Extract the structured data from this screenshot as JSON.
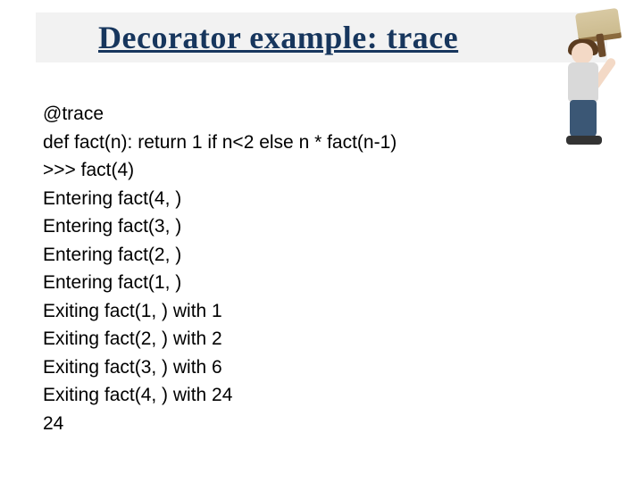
{
  "title": "Decorator example: trace",
  "code_lines": [
    "@trace",
    "def fact(n): return 1 if n<2 else n * fact(n-1)",
    ">>> fact(4)",
    "Entering fact(4, )",
    "Entering fact(3, )",
    "Entering fact(2, )",
    "Entering fact(1, )",
    "Exiting fact(1, ) with 1",
    "Exiting fact(2, ) with 2",
    "Exiting fact(3, ) with 6",
    "Exiting fact(4, ) with 24",
    "24"
  ],
  "decor_icon": "painter-illustration"
}
